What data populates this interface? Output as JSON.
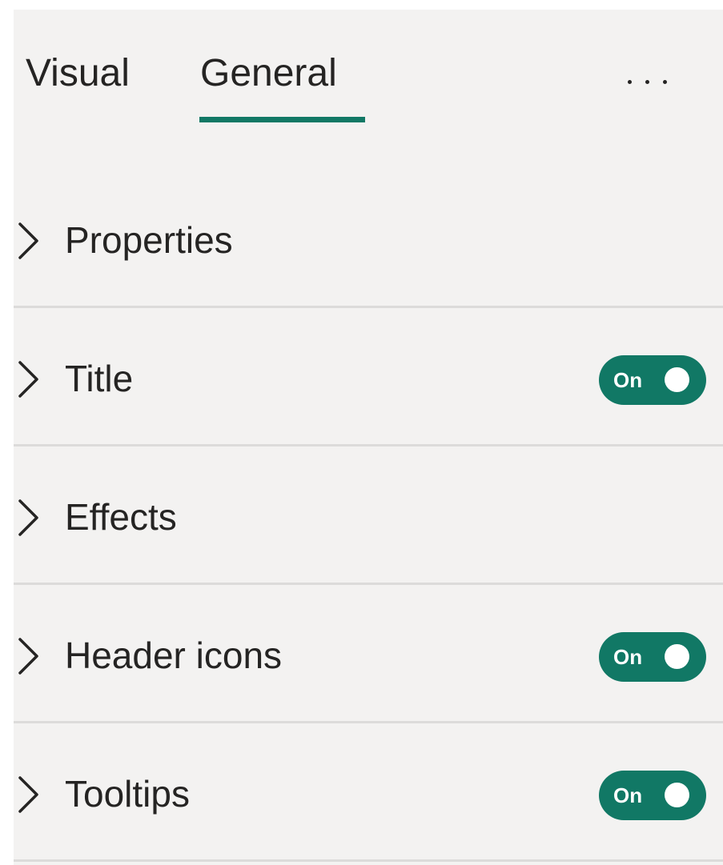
{
  "tabs": [
    {
      "label": "Visual",
      "active": false
    },
    {
      "label": "General",
      "active": true
    }
  ],
  "more_options": "more-options-icon",
  "sections": [
    {
      "label": "Properties",
      "icon": "chevron-right-icon",
      "toggle": null
    },
    {
      "label": "Title",
      "icon": "chevron-right-icon",
      "toggle": "On"
    },
    {
      "label": "Effects",
      "icon": "chevron-right-icon",
      "toggle": null
    },
    {
      "label": "Header icons",
      "icon": "chevron-right-icon",
      "toggle": "On"
    },
    {
      "label": "Tooltips",
      "icon": "chevron-right-icon",
      "toggle": "On"
    }
  ],
  "colors": {
    "accent": "#117865",
    "pane_background": "#f3f2f1",
    "divider": "#dcdbda",
    "text": "#252423"
  }
}
